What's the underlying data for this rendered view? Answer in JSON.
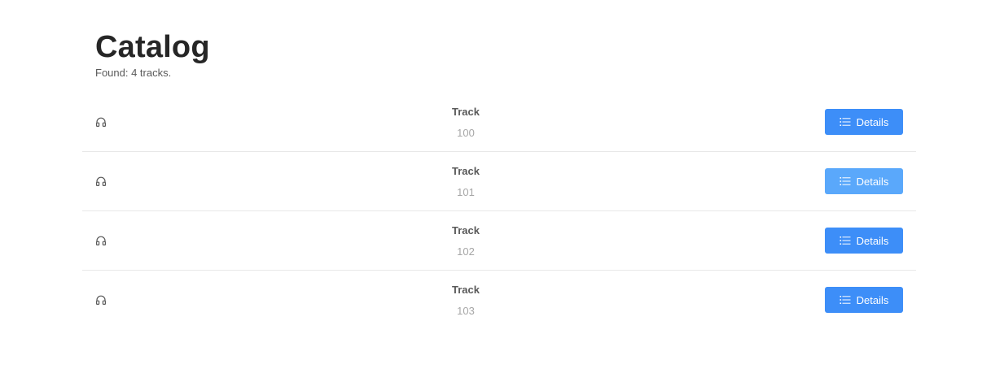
{
  "page": {
    "title": "Catalog",
    "subtitle": "Found: 4 tracks."
  },
  "tracks": [
    {
      "title": "Track",
      "description": "100",
      "button_label": "Details",
      "icon": "headphones-icon"
    },
    {
      "title": "Track",
      "description": "101",
      "button_label": "Details",
      "icon": "headphones-icon"
    },
    {
      "title": "Track",
      "description": "102",
      "button_label": "Details",
      "icon": "headphones-icon"
    },
    {
      "title": "Track",
      "description": "103",
      "button_label": "Details",
      "icon": "headphones-icon"
    }
  ],
  "colors": {
    "primary": "#3d8ef8",
    "primary_hover": "#5aa8fb",
    "divider": "#e8e8e8",
    "title_text": "#262626",
    "meta_title": "#595959",
    "meta_desc": "#a6a6a6"
  },
  "button_icon": "unordered-list-icon"
}
